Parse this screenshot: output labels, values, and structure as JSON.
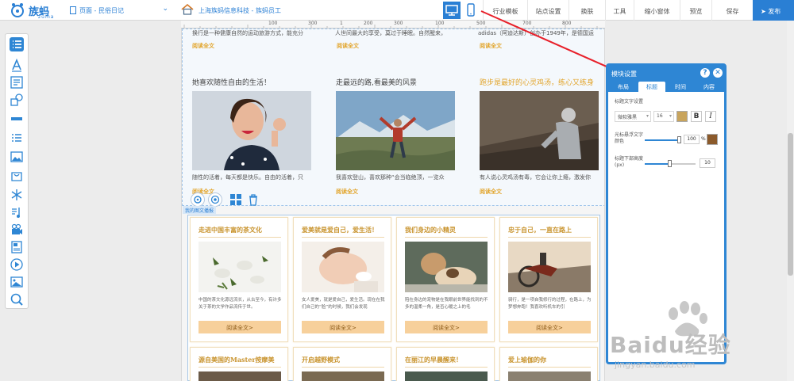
{
  "app": {
    "logo_text": "族蚂",
    "logo_sub": "zuma"
  },
  "topbar": {
    "page_select": "页面 - 民俗日记",
    "company": "上海族蚂信息科技 - 族蚂员工",
    "nav": [
      "行业模板",
      "站点设置",
      "换肤",
      "工具",
      "缩小窗体",
      "预览",
      "保存"
    ],
    "publish": "发布"
  },
  "ruler": {
    "ticks": [
      "100",
      "300",
      "1",
      "200",
      "300",
      "100",
      "500",
      "700",
      "800"
    ]
  },
  "colors": {
    "accent": "#2e86d4",
    "title_gold": "#c9942f",
    "readmore": "#e2a52c",
    "button_orange": "#f7d09b",
    "color_swatch_1": "#c8a45c",
    "color_swatch_2": "#8b5a2b"
  },
  "section1": {
    "fragments": [
      "换行是一种健康自然的运动旅游方式，能充分",
      "人世间最大的享受，莫过于睡眠。自然醒来，",
      "adidas（阿迪达斯）创办于1949年，是德国运"
    ],
    "read_more": "阅读全文",
    "articles": [
      {
        "title": "她喜欢随性自由的生活！",
        "desc": "随性的活着，每天都是快乐。自由的活着，只",
        "read_more": "阅读全文"
      },
      {
        "title": "走最远的路,看最美的风景",
        "desc": "我喜欢登山，喜欢那种“会当临绝顶，一览众",
        "read_more": "阅读全文"
      },
      {
        "title": "跑步是最好的心灵鸡汤，练心又练身",
        "desc": "有人说心灵鸡汤有毒，它会让你上瘾，激发你",
        "read_more": "阅读全文"
      }
    ],
    "tag": "我的图文播报"
  },
  "section2": {
    "cards": [
      {
        "title": "走进中国丰富的茶文化",
        "desc": "中国的茶文化源远流长，从古至今，有许多关于茶的文学作品流传于世。",
        "button": "阅读全文>"
      },
      {
        "title": "爱美就是爱自己，爱生活！",
        "desc": "女人爱美，就是爱自己，爱生活。现在在我们自己的“脸”的时候，我们会发现",
        "button": "阅读全文>"
      },
      {
        "title": "我们身边的小精灵",
        "desc": "陪在身边的宠物是在我眼前世界能找到的不多的温柔一角，是否心暖之上的毛",
        "button": "阅读全文>"
      },
      {
        "title": "忠于自己，一直在路上",
        "desc": "骑行，是一项自我修行的过程，在路上，为梦想奔跑！我喜欢听机车的引",
        "button": "阅读全文>"
      }
    ],
    "row2_titles": [
      "源自美国的Master按摩美",
      "开启越野模式",
      "在丽江的早晨醒来！",
      "爱上瑜伽的你"
    ]
  },
  "panel": {
    "title": "模块设置",
    "tabs": [
      "布局",
      "标题",
      "时间",
      "内容"
    ],
    "active_tab": "标题",
    "section_label": "标题文字设置",
    "font_family": "微软雅黑",
    "font_size": "16",
    "bold": "B",
    "italic": "I",
    "hover_label": "光标悬浮文字颜色",
    "hover_value": "100",
    "hover_unit": "%",
    "spacing_label": "标题下部高度(px)",
    "spacing_value": "10"
  },
  "watermark": {
    "text": "Baidu经验",
    "url": "jingyan.baidu.com"
  }
}
